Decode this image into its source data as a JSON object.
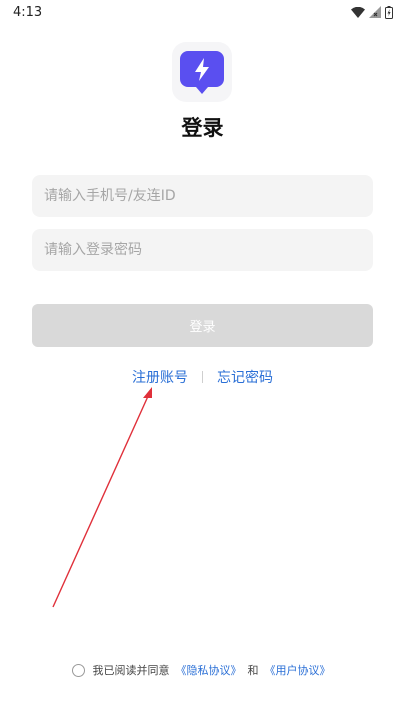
{
  "status_bar": {
    "time": "4:13"
  },
  "header": {
    "title": "登录"
  },
  "form": {
    "phone_placeholder": "请输入手机号/友连ID",
    "password_placeholder": "请输入登录密码",
    "login_label": "登录"
  },
  "links": {
    "register": "注册账号",
    "forgot": "忘记密码"
  },
  "agreement": {
    "prefix": "我已阅读并同意",
    "privacy": "《隐私协议》",
    "and": "和",
    "user": "《用户协议》"
  },
  "colors": {
    "brand": "#5a4ff0",
    "link": "#2a6fd6",
    "button_disabled": "#d9d9d9",
    "annotation_arrow": "#e0303a"
  }
}
